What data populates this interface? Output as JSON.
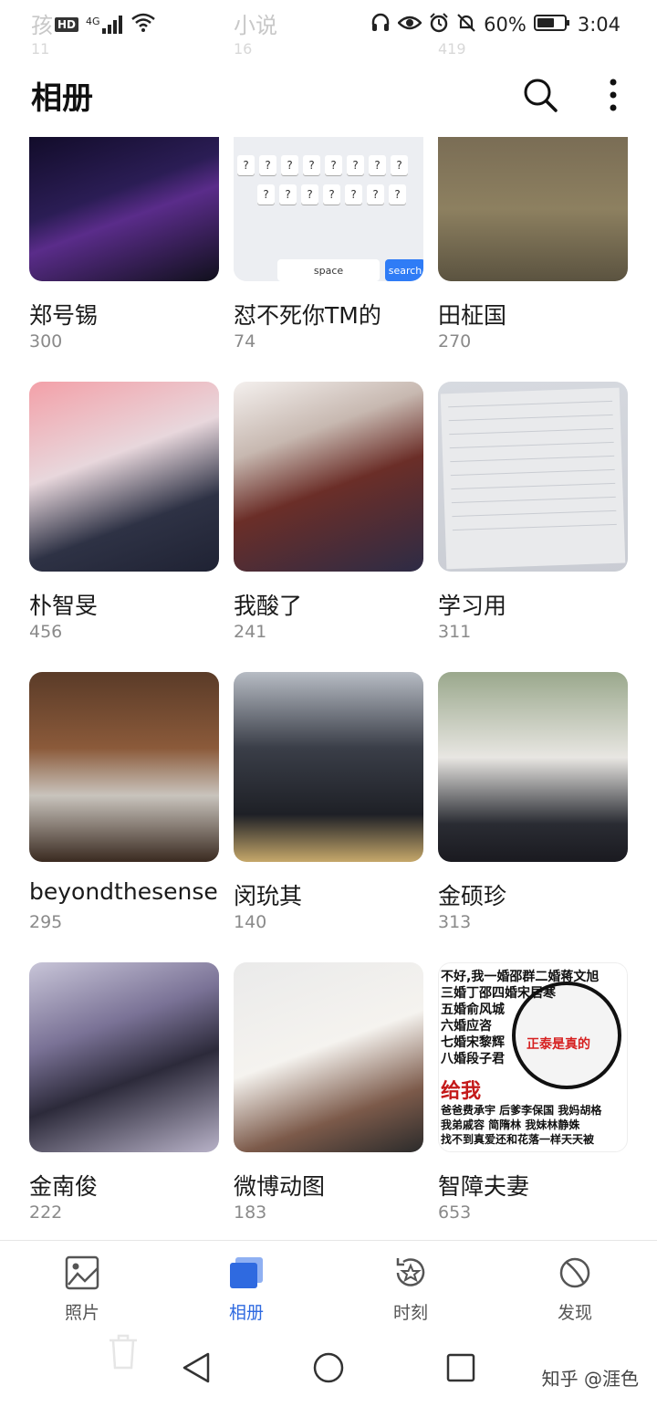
{
  "ghost_header": {
    "left_label": "孩",
    "middle_label": "小说",
    "left_count": "11",
    "middle_count": "16",
    "right_count": "419"
  },
  "status_bar": {
    "hd_label": "HD",
    "network": "4G",
    "battery_percent": "60%",
    "time": "3:04"
  },
  "app_bar": {
    "title": "相册",
    "search_icon": "search-icon",
    "more_icon": "more-vertical-icon"
  },
  "keyboard_thumb": {
    "key": "?",
    "space_label": "space",
    "search_label": "search"
  },
  "meme_thumb": {
    "lines": [
      "不好,我一婚邵群二婚蒋文旭",
      "三婚丁邵四婚宋居寒",
      "五婚俞风城",
      "六婚应咨",
      "七婚宋黎辉",
      "八婚段子君",
      "给我",
      "爸爸费承宇 后爹李保国 我妈胡格",
      "我弟戚容 简隋林 我妹林静姝",
      "找不到真爱还和花落一样天天被",
      "正泰是真的"
    ]
  },
  "albums": [
    {
      "name": "郑号锡",
      "count": "300"
    },
    {
      "name": "怼不死你TM的",
      "count": "74"
    },
    {
      "name": "田柾国",
      "count": "270"
    },
    {
      "name": "朴智旻",
      "count": "456"
    },
    {
      "name": "我酸了",
      "count": "241"
    },
    {
      "name": "学习用",
      "count": "311"
    },
    {
      "name": "beyondthesense",
      "count": "295"
    },
    {
      "name": "闵玧其",
      "count": "140"
    },
    {
      "name": "金硕珍",
      "count": "313"
    },
    {
      "name": "金南俊",
      "count": "222"
    },
    {
      "name": "微博动图",
      "count": "183"
    },
    {
      "name": "智障夫妻",
      "count": "653"
    }
  ],
  "bottom_nav": [
    {
      "label": "照片",
      "icon": "photo-icon",
      "active": false
    },
    {
      "label": "相册",
      "icon": "album-icon",
      "active": true
    },
    {
      "label": "时刻",
      "icon": "moments-icon",
      "active": false
    },
    {
      "label": "发现",
      "icon": "discover-icon",
      "active": false
    }
  ],
  "watermark": "知乎 @涯色",
  "colors": {
    "accent": "#2f6ae0",
    "count_gray": "#8a8a8a"
  }
}
